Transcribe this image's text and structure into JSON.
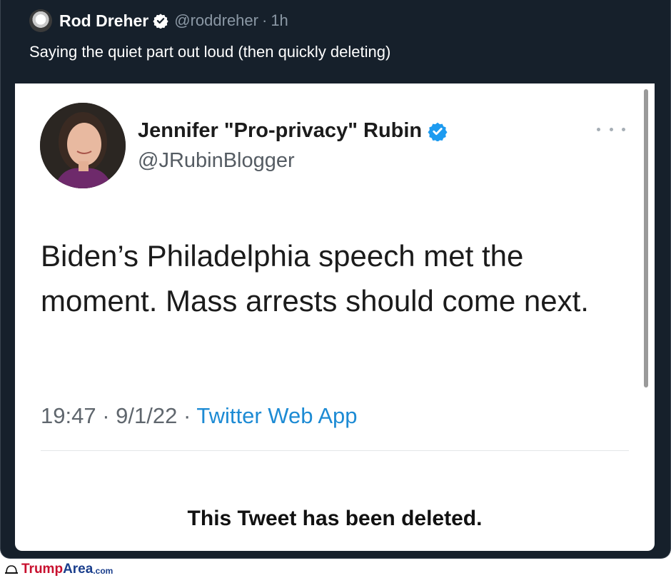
{
  "outer_tweet": {
    "author_name": "Rod Dreher",
    "author_handle": "@roddreher",
    "separator": "·",
    "time_ago": "1h",
    "text": "Saying the quiet part out loud (then quickly deleting)"
  },
  "quoted_tweet": {
    "author_name": "Jennifer \"Pro-privacy\" Rubin",
    "author_handle": "@JRubinBlogger",
    "body": "Biden’s Philadelphia speech met the moment.  Mass arrests should come next.",
    "time": "19:47",
    "date": "9/1/22",
    "separator": "·",
    "source": "Twitter Web App",
    "deleted_notice": "This Tweet has been deleted."
  },
  "watermark": {
    "part_a": "Trump",
    "part_b": "Area",
    "part_c": ".com"
  },
  "colors": {
    "outer_bg": "#16202b",
    "verified_blue": "#1d9bf0",
    "link_blue": "#1d8bd4"
  },
  "icons": {
    "verified": "verified-badge-icon",
    "more": "more-options-icon"
  }
}
